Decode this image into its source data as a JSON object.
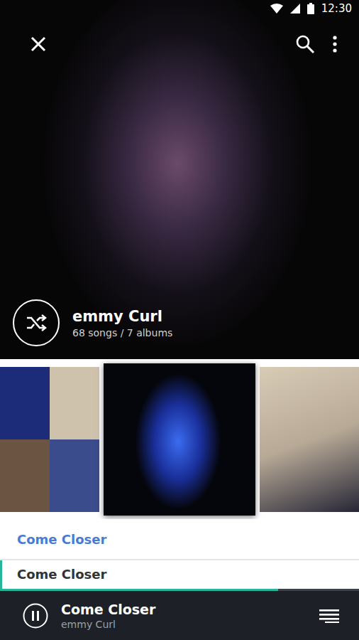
{
  "status_bar": {
    "time": "12:30"
  },
  "artist": {
    "name": "emmy Curl",
    "stats": "68 songs / 7 albums"
  },
  "albums": [
    {
      "selected": false,
      "kind": "collage"
    },
    {
      "selected": true,
      "kind": "cover"
    },
    {
      "selected": false,
      "kind": "cover"
    }
  ],
  "tracks": [
    {
      "title": "Come Closer",
      "kind": "album-title",
      "playing": false
    },
    {
      "title": "Come Closer",
      "kind": "track",
      "playing": true
    }
  ],
  "now_playing": {
    "title": "Come Closer",
    "artist": "emmy Curl",
    "playing": true,
    "level": 0.775
  }
}
